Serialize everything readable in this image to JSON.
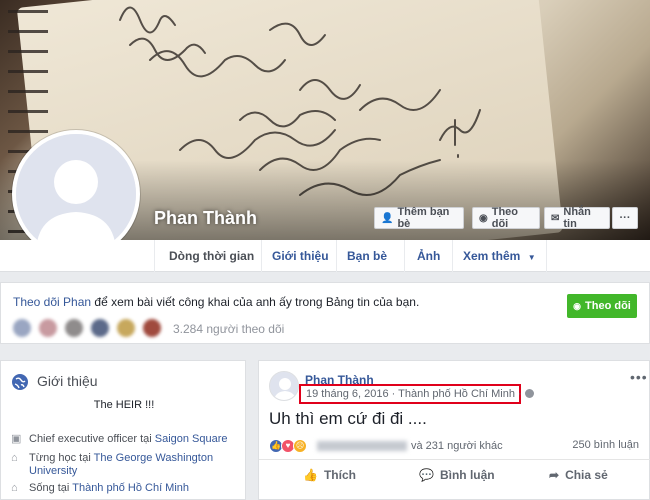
{
  "profile": {
    "name": "Phan Thành",
    "buttons": {
      "add_friend": "Thêm bạn bè",
      "follow": "Theo dõi",
      "message": "Nhắn tin",
      "more": "···"
    }
  },
  "nav": {
    "tabs": [
      "Dòng thời gian",
      "Giới thiệu",
      "Bạn bè",
      "Ảnh",
      "Xem thêm"
    ]
  },
  "follow_box": {
    "link": "Theo dõi Phan",
    "text": " để xem bài viết công khai của anh ấy trong Bảng tin của bạn.",
    "button": "Theo dõi",
    "count": "3.284 người theo dõi"
  },
  "intro": {
    "title": "Giới thiệu",
    "bio": "The HEIR !!!",
    "job_prefix": "Chief executive officer tại ",
    "job_link": "Saigon Square",
    "study_prefix": "Từng học tại ",
    "study_link": "The George Washington University",
    "live_prefix": "Sống tại ",
    "live_link": "Thành phố Hồ Chí Minh"
  },
  "post": {
    "author": "Phan Thành",
    "date": "19 tháng 6, 2016",
    "separator": "·",
    "location": "Thành phố Hồ Chí Minh",
    "text": "Uh thì em cứ đi đi ....",
    "reactions_others": "và 231 người khác",
    "comments": "250 bình luận",
    "actions": {
      "like": "Thích",
      "comment": "Bình luận",
      "share": "Chia sẻ"
    }
  },
  "colors": {
    "link": "#365899",
    "green": "#42b72a",
    "highlight": "#e0001b",
    "bg": "#e9ebee"
  }
}
